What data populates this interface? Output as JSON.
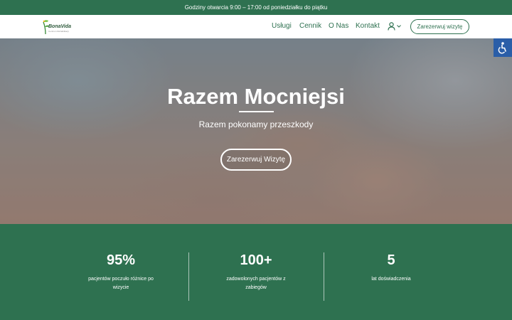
{
  "topbar": {
    "text": "Godziny otwarcia 9:00 – 17:00 od poniedziałku do piątku"
  },
  "logo": {
    "name": "BonaVida",
    "subtitle": "Centrum Rehabilitacji"
  },
  "nav": {
    "items": [
      {
        "label": "Usługi"
      },
      {
        "label": "Cennik"
      },
      {
        "label": "O Nas"
      },
      {
        "label": "Kontakt"
      }
    ],
    "cta_label": "Zarezerwuj wizytę"
  },
  "hero": {
    "title": "Razem Mocniejsi",
    "subtitle": "Razem pokonamy przeszkody",
    "cta_label": "Zarezerwuj Wizytę"
  },
  "stats": [
    {
      "value": "95%",
      "label": "pacjentów poczuło różnice po wizycie"
    },
    {
      "value": "100+",
      "label": "zadowolonych pacjentów z zabiegów"
    },
    {
      "value": "5",
      "label": "lat doświadczenia"
    }
  ],
  "colors": {
    "brand_green": "#2e7150",
    "accessibility_blue": "#2a5ea8",
    "white": "#ffffff"
  },
  "icons": [
    "user-icon",
    "chevron-down-icon",
    "accessibility-icon",
    "logo-leaf-icon"
  ]
}
